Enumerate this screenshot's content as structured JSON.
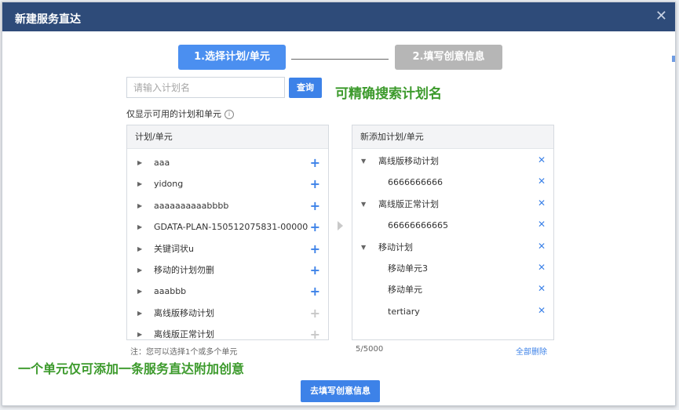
{
  "dialog": {
    "title": "新建服务直达",
    "close_icon": "close-icon"
  },
  "steps": [
    {
      "label": "1.选择计划/单元",
      "state": "active",
      "color": "#4b8ff0"
    },
    {
      "label": "2.填写创意信息",
      "state": "inactive",
      "color": "#b6b6b6"
    }
  ],
  "search": {
    "placeholder": "请输入计划名",
    "value": "",
    "button_label": "查询"
  },
  "annotations": {
    "search_hint": "可精确搜索计划名",
    "unit_hint": "一个单元仅可添加一条服务直达附加创意",
    "color": "#3c9a2c"
  },
  "filter_label": "仅显示可用的计划和单元",
  "left_panel": {
    "header": "计划/单元",
    "items": [
      {
        "label": "aaa",
        "addable": true
      },
      {
        "label": "yidong",
        "addable": true
      },
      {
        "label": "aaaaaaaaaabbbb",
        "addable": true
      },
      {
        "label": "GDATA-PLAN-150512075831-00000",
        "addable": true
      },
      {
        "label": "关键词状u",
        "addable": true
      },
      {
        "label": "移动的计划勿删",
        "addable": true
      },
      {
        "label": "aaabbb",
        "addable": true
      },
      {
        "label": "离线版移动计划",
        "addable": false
      },
      {
        "label": "离线版正常计划",
        "addable": false
      }
    ],
    "note": "注：您可以选择1个或多个单元"
  },
  "right_panel": {
    "header": "新添加计划/单元",
    "items": [
      {
        "label": "离线版移动计划",
        "level": "plan"
      },
      {
        "label": "6666666666",
        "level": "unit"
      },
      {
        "label": "离线版正常计划",
        "level": "plan"
      },
      {
        "label": "66666666665",
        "level": "unit"
      },
      {
        "label": "移动计划",
        "level": "plan"
      },
      {
        "label": "移动单元3",
        "level": "unit"
      },
      {
        "label": "移动单元",
        "level": "unit"
      },
      {
        "label": "tertiary",
        "level": "unit"
      }
    ],
    "count": "5/5000",
    "clear_all": "全部删除"
  },
  "footer": {
    "next_button": "去填写创意信息"
  },
  "colors": {
    "title_bar": "#2e4b79",
    "accent": "#3d82e8"
  }
}
